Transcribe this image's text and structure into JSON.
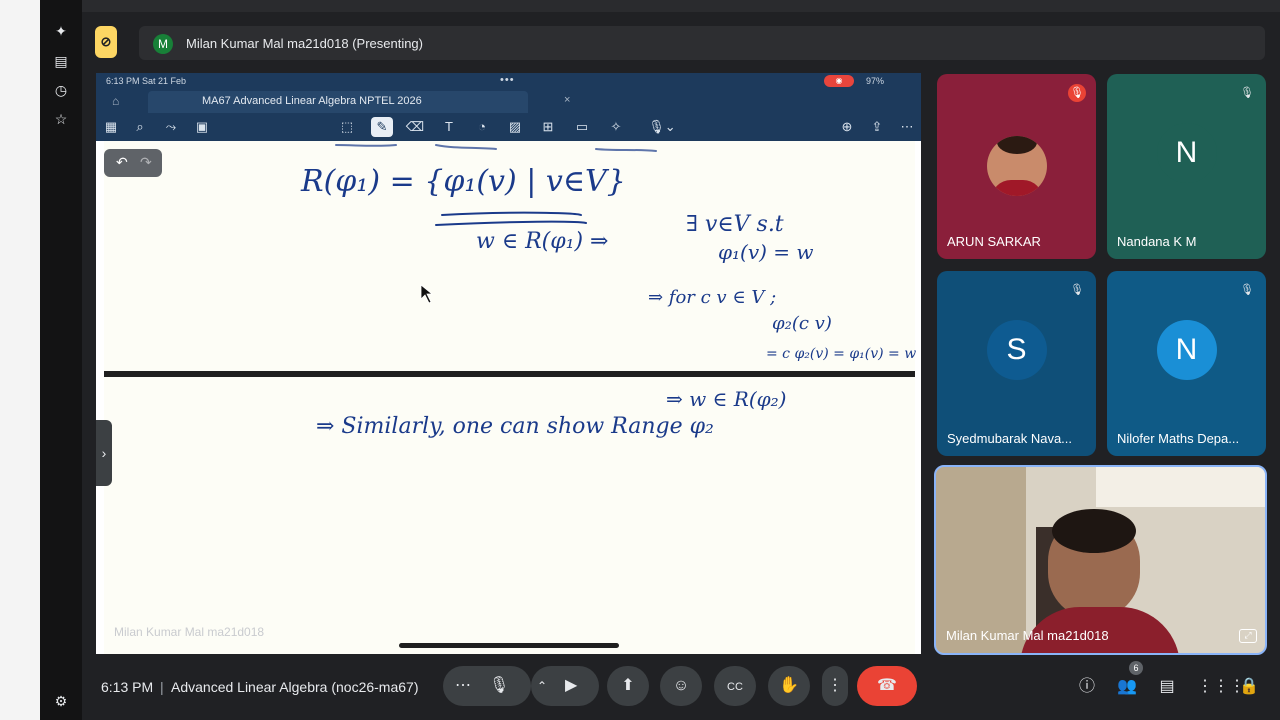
{
  "presenter_banner": {
    "avatar_initial": "M",
    "text": "Milan Kumar Mal ma21d018 (Presenting)",
    "icon": "present-off-icon"
  },
  "shared_screen": {
    "status_time": "6:13 PM  Sat 21 Feb",
    "battery": "97%",
    "tab_title": "MA67 Advanced Linear Algebra NPTEL 2026",
    "tab_chevron": "⌄",
    "watermark": "Milan Kumar Mal ma21d018",
    "handwriting": {
      "line1": "R(φ₁) = {φ₁(v) | v∈V}",
      "line2": "w ∈ R(φ₁) ⇒",
      "line3": "∃ v∈V s.t",
      "line4": "φ₁(v) = w",
      "line5": "⇒ for c v ∈ V ;",
      "line6": "φ₂(c v)",
      "line7": "= c φ₂(v) = φ₁(v) = w",
      "line8": "⇒ w ∈ R(φ₂)",
      "line9": "⇒ Similarly, one can show Range φ₂"
    }
  },
  "participants": [
    {
      "name": "ARUN SARKAR",
      "initial": "",
      "muted": true,
      "bg": "#8a1f3a",
      "mic_red": true
    },
    {
      "name": "Nandana K M",
      "initial": "N",
      "muted": true,
      "bg": "#1f6055",
      "avatar_bg": "#1f6055"
    },
    {
      "name": "Syedmubarak Nava...",
      "initial": "S",
      "muted": true,
      "bg": "#0f4f78",
      "avatar_bg": "#0e5b91"
    },
    {
      "name": "Nilofer Maths Depa...",
      "initial": "N",
      "muted": true,
      "bg": "#0f5a86",
      "avatar_bg": "#1a8fd6"
    }
  ],
  "self_view": {
    "name": "Milan Kumar Mal ma21d018"
  },
  "bottom_bar": {
    "time": "6:13 PM",
    "separator": "|",
    "meeting_title": "Advanced Linear Algebra (noc26-ma67)",
    "participant_count": "6"
  },
  "colors": {
    "accent_red": "#ea4335",
    "banner_yellow": "#fdd663",
    "tile_dark": "#3c4043",
    "self_border": "#8ab4f8"
  }
}
